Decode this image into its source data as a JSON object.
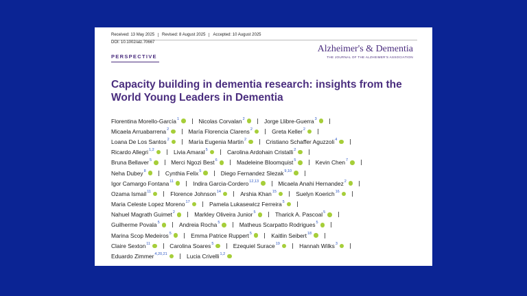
{
  "history": {
    "received": "Received: 13 May 2025",
    "revised": "Revised: 8 August 2025",
    "accepted": "Accepted: 10 August 2025"
  },
  "doi": "DOI: 10.1002/alz.70667",
  "article_type": "PERSPECTIVE",
  "journal": {
    "name": "Alzheimer's & Dementia",
    "tagline": "THE JOURNAL OF THE ALZHEIMER'S ASSOCIATION",
    "color": "#4a2d7e"
  },
  "title": "Capacity building in dementia research: insights from the World Young Leaders in Dementia",
  "colors": {
    "background": "#0b2494",
    "orcid": "#a6ce39",
    "title": "#4a2d7e"
  },
  "author_lines": [
    [
      {
        "name": "Florentina Morello-García",
        "aff": "1",
        "sep": true
      },
      {
        "name": "Nicolas Corvalan",
        "aff": "2",
        "sep": true
      },
      {
        "name": "Jorge Llibre-Guerra",
        "aff": "3",
        "sep": true
      }
    ],
    [
      {
        "name": "Micaela Arruabarrena",
        "aff": "2",
        "sep": true
      },
      {
        "name": "María Florencia Clarens",
        "aff": "2",
        "sep": true
      },
      {
        "name": "Greta Keller",
        "aff": "2",
        "sep": true
      }
    ],
    [
      {
        "name": "Loana De Los Santos",
        "aff": "2",
        "sep": true
      },
      {
        "name": "María Eugenia Martin",
        "aff": "2",
        "sep": true
      },
      {
        "name": "Cristiano Schaffer Aguzzoli",
        "aff": "4",
        "sep": true
      }
    ],
    [
      {
        "name": "Ricardo Allegri",
        "aff": "1,2",
        "sep": true
      },
      {
        "name": "Livia Amaral",
        "aff": "5",
        "sep": true
      },
      {
        "name": "Carolina Ardohain Cristalli",
        "aff": "2",
        "sep": true
      }
    ],
    [
      {
        "name": "Bruna Bellaver",
        "aff": "5",
        "sep": true
      },
      {
        "name": "Merci Ngozi Best",
        "aff": "6",
        "sep": true
      },
      {
        "name": "Madeleine Bloomquist",
        "aff": "5",
        "sep": true
      },
      {
        "name": "Kevin Chen",
        "aff": "7",
        "sep": true
      }
    ],
    [
      {
        "name": "Neha Dubey",
        "aff": "8",
        "sep": true
      },
      {
        "name": "Cynthia Felix",
        "aff": "5",
        "sep": true
      },
      {
        "name": "Diego Fernandez Slezak",
        "aff": "9,10",
        "sep": true
      }
    ],
    [
      {
        "name": "Igor Camargo Fontana",
        "aff": "11",
        "sep": true
      },
      {
        "name": "Indira Garcia-Cordero",
        "aff": "12,13",
        "sep": true
      },
      {
        "name": "Micaela Anahi Hernandez",
        "aff": "2",
        "sep": true
      }
    ],
    [
      {
        "name": "Ozama Ismail",
        "aff": "11",
        "sep": true
      },
      {
        "name": "Florence Johnson",
        "aff": "14",
        "sep": true
      },
      {
        "name": "Arshia Khan",
        "aff": "15",
        "sep": true
      },
      {
        "name": "Suelyn Koerich",
        "aff": "16",
        "sep": true
      }
    ],
    [
      {
        "name": "Maria Celeste Lopez Moreno",
        "aff": "17",
        "sep": true
      },
      {
        "name": "Pamela Lukasewicz Ferreira",
        "aff": "5",
        "sep": true
      }
    ],
    [
      {
        "name": "Nahuel Magrath Guimet",
        "aff": "2",
        "sep": true
      },
      {
        "name": "Markley Oliveira Junior",
        "aff": "5",
        "sep": true
      },
      {
        "name": "Tharick A. Pascoal",
        "aff": "5",
        "sep": true
      }
    ],
    [
      {
        "name": "Guilherme Povala",
        "aff": "5",
        "sep": true
      },
      {
        "name": "Andreia Rocha",
        "aff": "5",
        "sep": true
      },
      {
        "name": "Matheus Scarpatto Rodrigues",
        "aff": "5",
        "sep": true
      }
    ],
    [
      {
        "name": "Marina Scop Medeiros",
        "aff": "5",
        "sep": true
      },
      {
        "name": "Emma Patrice Ruppert",
        "aff": "5",
        "sep": true
      },
      {
        "name": "Kaitlin Seibert",
        "aff": "18",
        "sep": true
      }
    ],
    [
      {
        "name": "Claire Sexton",
        "aff": "11",
        "sep": true
      },
      {
        "name": "Carolina Soares",
        "aff": "5",
        "sep": true
      },
      {
        "name": "Ezequiel Surace",
        "aff": "19",
        "sep": true
      },
      {
        "name": "Hannah Wilks",
        "aff": "3",
        "sep": true
      }
    ],
    [
      {
        "name": "Eduardo Zimmer",
        "aff": "4,20,21",
        "sep": true
      },
      {
        "name": "Lucia Crivelli",
        "aff": "1,2",
        "sep": false
      }
    ]
  ]
}
